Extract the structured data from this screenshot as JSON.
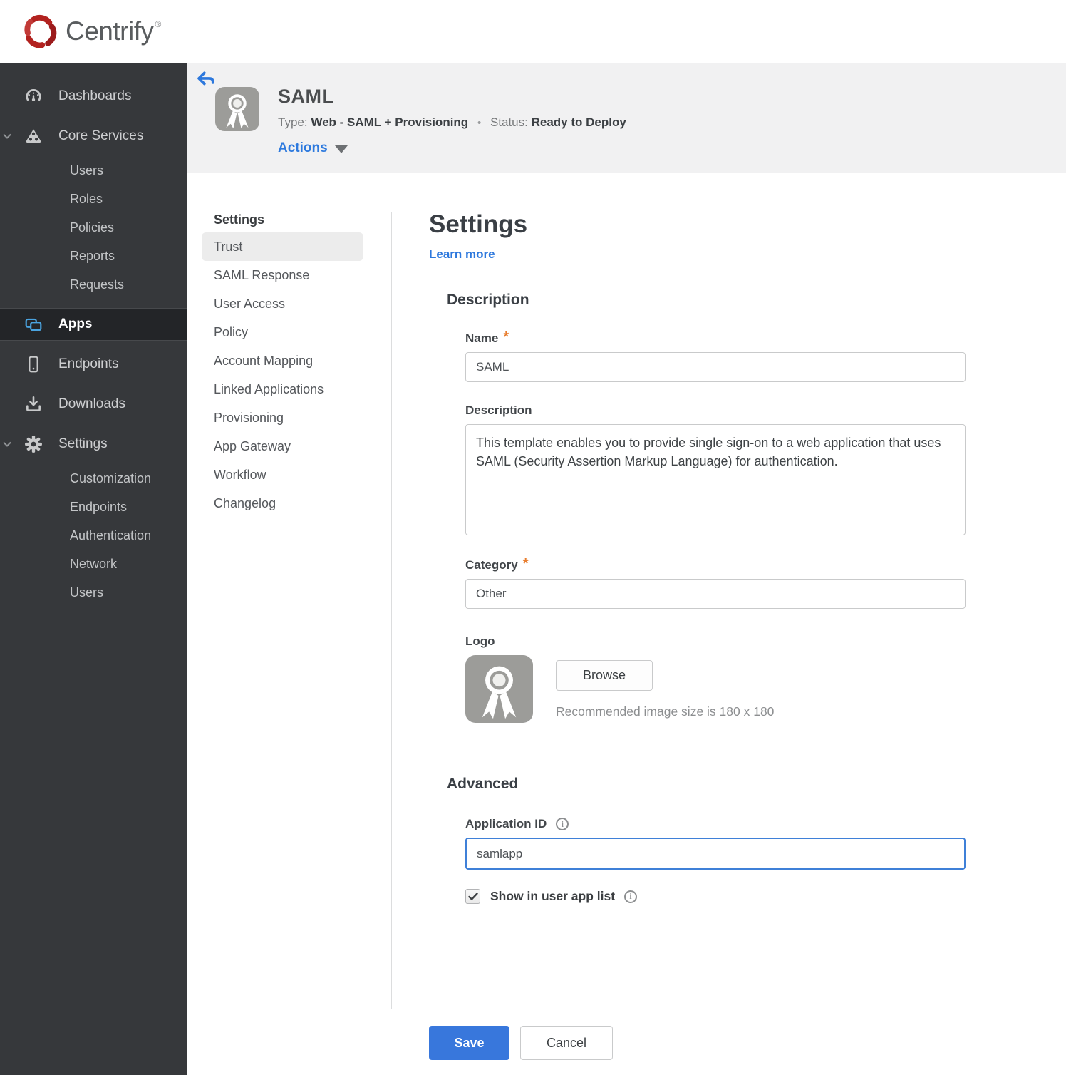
{
  "brand": {
    "name": "Centrify",
    "mark": "®"
  },
  "sidebar": {
    "dashboards": "Dashboards",
    "core_services": "Core Services",
    "core_children": [
      "Users",
      "Roles",
      "Policies",
      "Reports",
      "Requests"
    ],
    "apps": "Apps",
    "endpoints": "Endpoints",
    "downloads": "Downloads",
    "settings": "Settings",
    "settings_children": [
      "Customization",
      "Endpoints",
      "Authentication",
      "Network",
      "Users"
    ]
  },
  "header": {
    "app_title": "SAML",
    "type_label": "Type:",
    "type_value": "Web - SAML + Provisioning",
    "separator": "•",
    "status_label": "Status:",
    "status_value": "Ready to Deploy",
    "actions_label": "Actions"
  },
  "subnav": {
    "heading": "Settings",
    "items": [
      "Trust",
      "SAML Response",
      "User Access",
      "Policy",
      "Account Mapping",
      "Linked Applications",
      "Provisioning",
      "App Gateway",
      "Workflow",
      "Changelog"
    ],
    "active_item": "Trust"
  },
  "main": {
    "title": "Settings",
    "learn_more": "Learn more",
    "description_section": {
      "heading": "Description",
      "name_label": "Name",
      "required_mark": "*",
      "name_value": "SAML",
      "description_label": "Description",
      "description_value": "This template enables you to provide single sign-on to a web application that uses SAML (Security Assertion Markup Language) for authentication.",
      "category_label": "Category",
      "category_value": "Other",
      "logo_label": "Logo",
      "browse_button": "Browse",
      "logo_hint": "Recommended image size is 180 x 180"
    },
    "advanced_section": {
      "heading": "Advanced",
      "app_id_label": "Application ID",
      "app_id_value": "samlapp",
      "show_in_app_list_label": "Show in user app list",
      "checkbox_checked": true
    },
    "footer": {
      "save": "Save",
      "cancel": "Cancel"
    }
  },
  "icons": {
    "info": "i"
  },
  "colors": {
    "accent_blue": "#2d78dd",
    "save_blue": "#3877dc",
    "status_red": "#a32022",
    "required_orange": "#e87d2e",
    "sidebar_bg": "#36383b",
    "sidebar_active_bg": "#232528",
    "apps_icon_blue": "#4aa3df",
    "header_strip": "#f1f1f2"
  }
}
